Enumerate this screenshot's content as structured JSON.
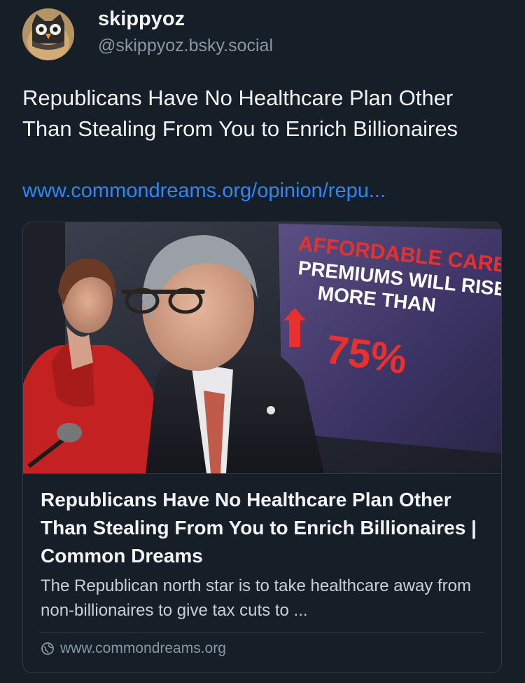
{
  "author": {
    "display_name": "skippyoz",
    "handle": "@skippyoz.bsky.social",
    "avatar_icon": "owl-avatar-icon"
  },
  "post": {
    "text": "Republicans Have No Healthcare Plan Other Than Stealing From You to Enrich Billionaires",
    "link_text": "www.commondreams.org/opinion/repu..."
  },
  "embed_card": {
    "image_sign": {
      "line1": "AFFORDABLE CARE ACT",
      "line2": "PREMIUMS WILL RISE",
      "line3": "MORE THAN",
      "line4": "75%"
    },
    "title": "Republicans Have No Healthcare Plan Other Than Stealing From You to Enrich Billionaires | Common Dreams",
    "description": "The Republican north star is to take healthcare away from non-billionaires to give tax cuts to ...",
    "domain": "www.commondreams.org",
    "domain_icon": "globe-icon"
  },
  "colors": {
    "background": "#161e27",
    "link": "#2f86f6",
    "muted": "#8a96a4",
    "border": "#2f3b48",
    "sign_text_red": "#e8312f"
  }
}
